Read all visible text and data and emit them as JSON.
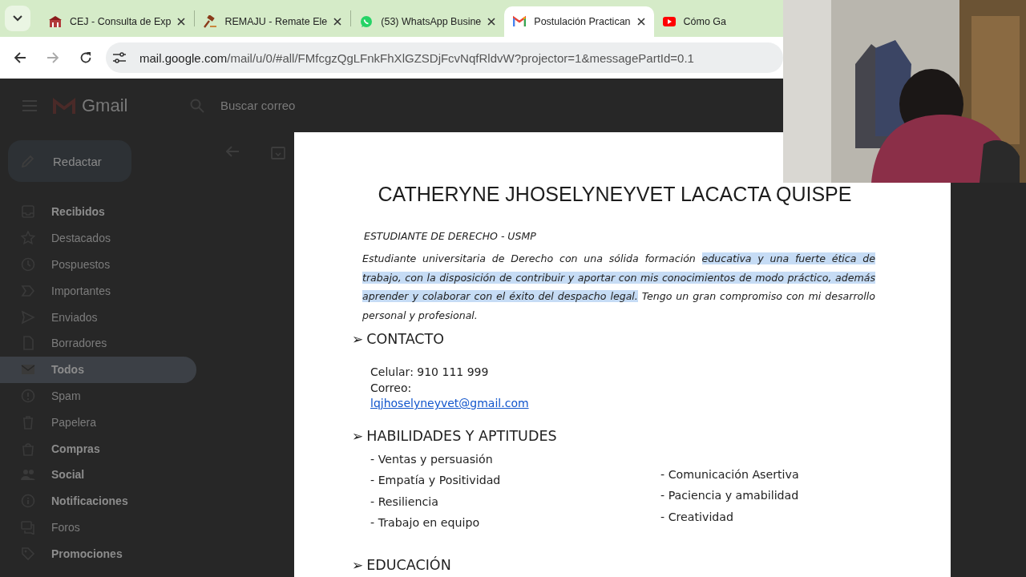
{
  "browser": {
    "tabs": [
      {
        "title": "CEJ - Consulta de Exp",
        "kind": "building",
        "selected": false
      },
      {
        "title": "REMAJU - Remate Ele",
        "kind": "gavel",
        "selected": false
      },
      {
        "title": "(53) WhatsApp Busine",
        "kind": "chat",
        "selected": false
      },
      {
        "title": "Postulación Practican",
        "kind": "mail",
        "selected": true
      },
      {
        "title": "Cómo Ga",
        "kind": "video",
        "selected": false
      }
    ],
    "address_bar": {
      "host": "mail.google.com",
      "path": "/mail/u/0/#all/FMfcgzQgLFnkFhXlGZSDjFcvNqfRldvW?projector=1&messagePartId=0.1"
    }
  },
  "gmail": {
    "app_name": "Gmail",
    "search": {
      "placeholder": "Buscar correo"
    },
    "compose": "Redactar",
    "nav": [
      {
        "label": "Recibidos",
        "kind": "inbox",
        "unread": true,
        "selected": false
      },
      {
        "label": "Destacados",
        "kind": "star",
        "unread": false,
        "selected": false
      },
      {
        "label": "Pospuestos",
        "kind": "clock",
        "unread": false,
        "selected": false
      },
      {
        "label": "Importantes",
        "kind": "label",
        "unread": false,
        "selected": false
      },
      {
        "label": "Enviados",
        "kind": "send",
        "unread": false,
        "selected": false
      },
      {
        "label": "Borradores",
        "kind": "file",
        "unread": false,
        "selected": false
      },
      {
        "label": "Todos",
        "kind": "mail",
        "unread": true,
        "selected": true
      },
      {
        "label": "Spam",
        "kind": "alert",
        "unread": false,
        "selected": false
      },
      {
        "label": "Papelera",
        "kind": "trash",
        "unread": false,
        "selected": false
      },
      {
        "label": "Compras",
        "kind": "bag",
        "unread": true,
        "selected": false
      },
      {
        "label": "Social",
        "kind": "people",
        "unread": true,
        "selected": false
      },
      {
        "label": "Notificaciones",
        "kind": "info",
        "unread": true,
        "selected": false
      },
      {
        "label": "Foros",
        "kind": "forum",
        "unread": false,
        "selected": false
      },
      {
        "label": "Promociones",
        "kind": "tag",
        "unread": true,
        "selected": false
      }
    ]
  },
  "document": {
    "name": "CATHERYNE JHOSELYNEYVET LACACTA QUISPE",
    "subtitle": "ESTUDIANTE DE DERECHO - USMP",
    "summary": [
      {
        "text": "Estudiante universitaria de Derecho con una sólida formación ",
        "highlighted": false
      },
      {
        "text": "educativa y una fuerte ética de trabajo, con la disposición de contribuir y aportar con mis conocimientos de modo práctico, además aprender y colaborar con el éxito del despacho legal.",
        "highlighted": true
      },
      {
        "text": " Tengo un gran compromiso con mi desarrollo personal y profesional.",
        "highlighted": false
      }
    ],
    "sections": [
      {
        "kind": "contact",
        "marker": "➢",
        "title": "CONTACTO",
        "lines": [
          "Celular: 910 111 999",
          "Correo:"
        ],
        "email": "lqjhoselyneyvet@gmail.com"
      },
      {
        "kind": "skills",
        "marker": "➢",
        "title": "HABILIDADES Y APTITUDES",
        "columns": [
          [
            "- Ventas y persuasión",
            "- Empatía y Positividad",
            "- Resiliencia",
            "- Trabajo en equipo"
          ],
          [
            "- Comunicación Asertiva",
            "- Paciencia y amabilidad",
            "- Creatividad"
          ]
        ]
      },
      {
        "kind": "heading",
        "marker": "➢",
        "title": "EDUCACIÓN"
      }
    ]
  }
}
